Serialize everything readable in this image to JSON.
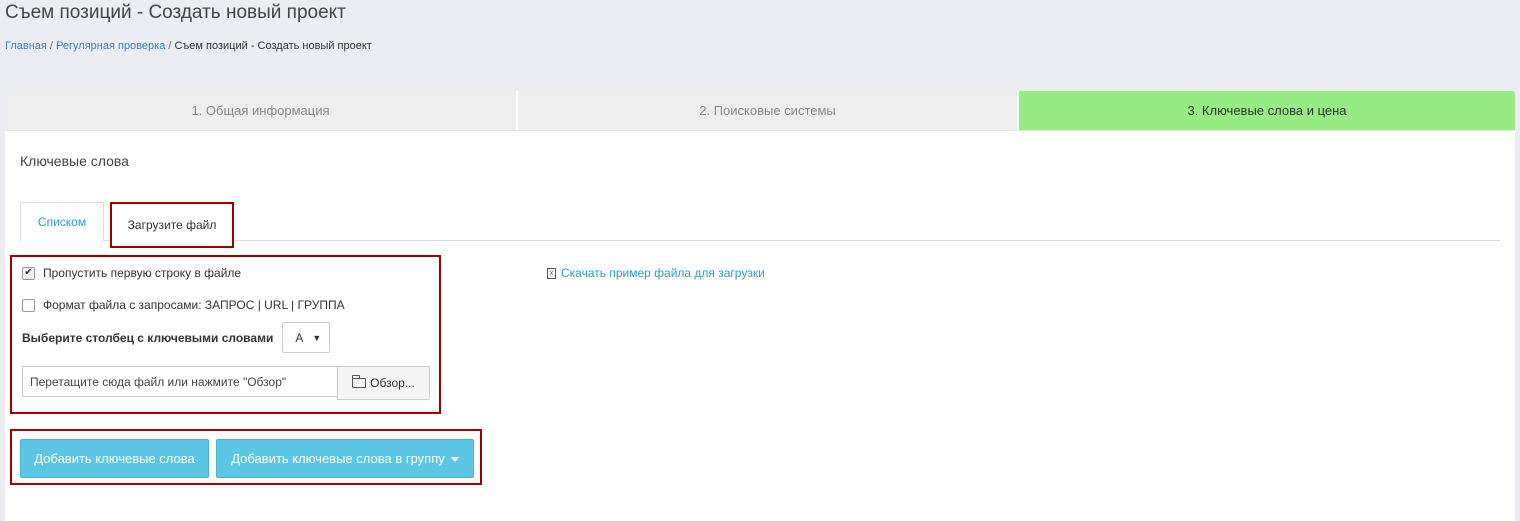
{
  "page": {
    "title": "Съем позиций - Создать новый проект"
  },
  "breadcrumb": {
    "home": "Главная",
    "sep1": " / ",
    "regular": "Регулярная проверка",
    "sep2": " / ",
    "current": "Съем позиций - Создать новый проект"
  },
  "steps": [
    {
      "label": "1. Общая информация",
      "active": false
    },
    {
      "label": "2. Поисковые системы",
      "active": false
    },
    {
      "label": "3. Ключевые слова и цена",
      "active": true
    }
  ],
  "section": {
    "title": "Ключевые слова"
  },
  "tabs": {
    "list": "Списком",
    "upload": "Загрузите файл",
    "selected": "upload"
  },
  "options": {
    "skip_first_row": {
      "label": "Пропустить первую строку в файле",
      "checked": true
    },
    "format": {
      "label": "Формат файла с запросами: ЗАПРОС | URL | ГРУППА",
      "checked": false
    },
    "column": {
      "label": "Выберите столбец с ключевыми словами",
      "value": "A"
    }
  },
  "file_input": {
    "placeholder": "Перетащите сюда файл или нажмите \"Обзор\"",
    "browse_label": "Обзор..."
  },
  "download": {
    "label": "Скачать пример файла для загрузки"
  },
  "actions": {
    "add": "Добавить ключевые слова",
    "add_group": "Добавить ключевые слова в группу"
  },
  "colors": {
    "active_step": "#96ec82",
    "button": "#5bc7e5",
    "link": "#2a9fbf",
    "highlight_border": "#a00000"
  }
}
